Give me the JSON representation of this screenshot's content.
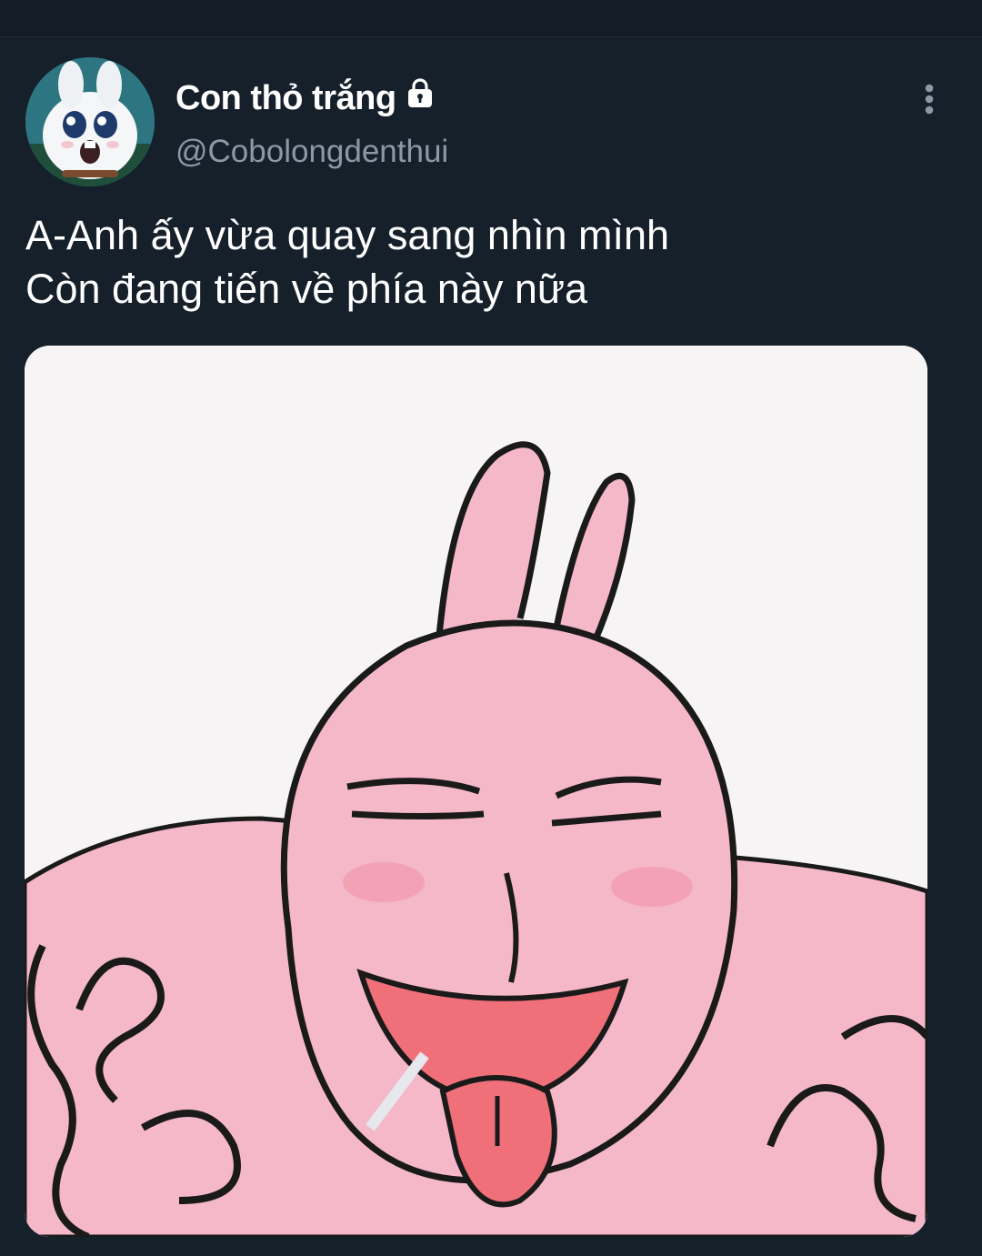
{
  "author": {
    "display_name": "Con thỏ trắng",
    "handle": "@Cobolongdenthui",
    "protected": true,
    "avatar_icon": "white-rabbit-avatar"
  },
  "tweet": {
    "text_lines": [
      "A-Anh ấy vừa quay sang nhìn mình",
      "Còn đang tiến về phía này nữa"
    ],
    "media_icon": "pink-rabbit-cartoon-image"
  },
  "actions": {
    "more_icon": "more-vertical-icon"
  },
  "colors": {
    "background": "#15202b",
    "text_primary": "#ffffff",
    "text_secondary": "#8b98a5",
    "rabbit_pink": "#f5b8c8",
    "tongue": "#ef7078"
  }
}
